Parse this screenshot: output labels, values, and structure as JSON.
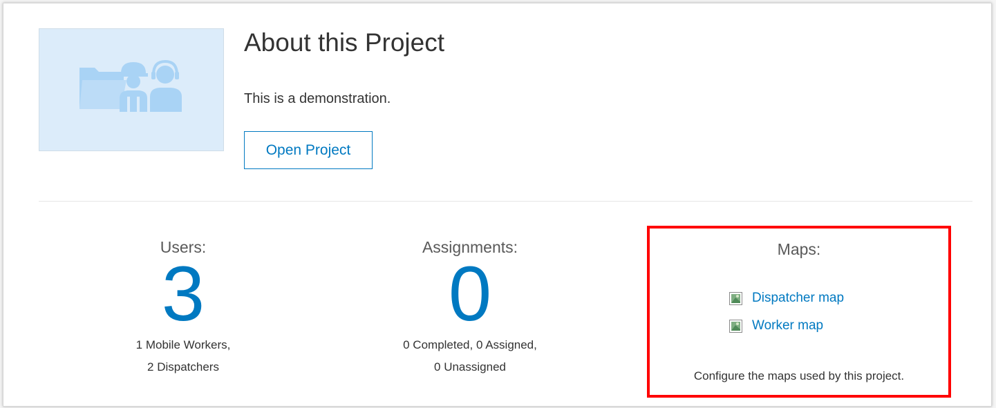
{
  "project": {
    "thumbnail_icon": "project-team-icon",
    "title": "About this Project",
    "description": "This is a demonstration.",
    "open_label": "Open Project"
  },
  "stats": {
    "users": {
      "label": "Users:",
      "value": "3",
      "detail_line1": "1 Mobile Workers,",
      "detail_line2": "2 Dispatchers"
    },
    "assignments": {
      "label": "Assignments:",
      "value": "0",
      "detail_line1": "0 Completed, 0 Assigned,",
      "detail_line2": "0 Unassigned"
    }
  },
  "maps": {
    "label": "Maps:",
    "links": [
      {
        "label": "Dispatcher map",
        "icon": "map-thumbnail-icon"
      },
      {
        "label": "Worker map",
        "icon": "map-thumbnail-icon"
      }
    ],
    "config_text": "Configure the maps used by this project."
  },
  "colors": {
    "accent": "#0079c1",
    "highlight_box": "#ff0000",
    "thumbnail_bg": "#dcecfa",
    "thumbnail_icon": "#a9d3f5"
  }
}
